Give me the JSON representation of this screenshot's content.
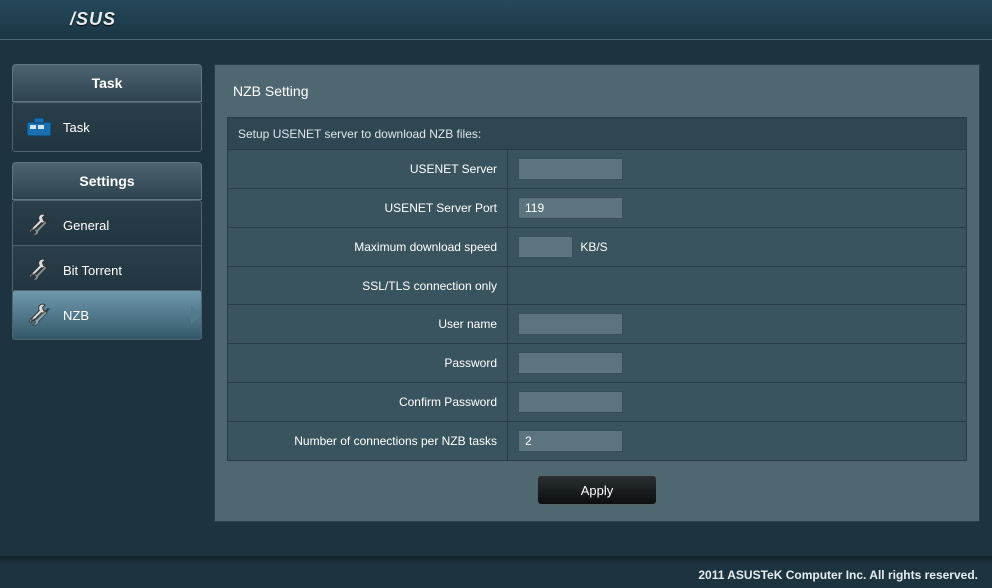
{
  "brand": "/SUS",
  "sidebar": {
    "task_header": "Task",
    "task_item": "Task",
    "settings_header": "Settings",
    "items": [
      {
        "label": "General"
      },
      {
        "label": "Bit Torrent"
      },
      {
        "label": "NZB"
      }
    ]
  },
  "panel": {
    "title": "NZB Setting",
    "section_label": "Setup USENET server to download NZB files:",
    "fields": {
      "server_label": "USENET Server",
      "server_value": "",
      "port_label": "USENET Server Port",
      "port_value": "119",
      "speed_label": "Maximum download speed",
      "speed_value": "",
      "speed_unit": "KB/S",
      "ssl_label": "SSL/TLS connection only",
      "username_label": "User name",
      "username_value": "",
      "password_label": "Password",
      "password_value": "",
      "confirm_label": "Confirm Password",
      "confirm_value": "",
      "conn_label": "Number of connections per NZB tasks",
      "conn_value": "2"
    },
    "apply_label": "Apply"
  },
  "footer": "2011 ASUSTeK Computer Inc. All rights reserved."
}
